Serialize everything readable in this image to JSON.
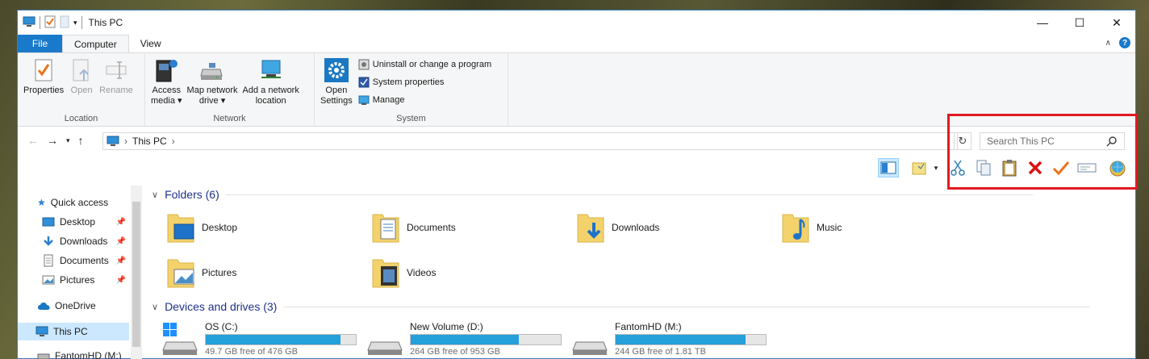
{
  "window": {
    "title": "This PC"
  },
  "controls": {
    "minimize": "—",
    "maximize": "☐",
    "close": "✕"
  },
  "tabs": [
    {
      "label": "File"
    },
    {
      "label": "Computer"
    },
    {
      "label": "View"
    }
  ],
  "ribbon": {
    "location": {
      "label": "Location",
      "properties": "Properties",
      "open": "Open",
      "rename": "Rename"
    },
    "network": {
      "label": "Network",
      "access_media_1": "Access",
      "access_media_2": "media",
      "map_drive_1": "Map network",
      "map_drive_2": "drive",
      "add_location_1": "Add a network",
      "add_location_2": "location"
    },
    "system": {
      "label": "System",
      "open_settings_1": "Open",
      "open_settings_2": "Settings",
      "uninstall": "Uninstall or change a program",
      "system_properties": "System properties",
      "manage": "Manage"
    }
  },
  "address": {
    "path": "This PC",
    "search_placeholder": "Search This PC"
  },
  "navpane": [
    {
      "label": "Quick access",
      "icon": "star-icon"
    },
    {
      "label": "Desktop",
      "icon": "desktop-icon",
      "pinned": true
    },
    {
      "label": "Downloads",
      "icon": "download-icon",
      "pinned": true
    },
    {
      "label": "Documents",
      "icon": "documents-icon",
      "pinned": true
    },
    {
      "label": "Pictures",
      "icon": "pictures-icon",
      "pinned": true
    },
    {
      "label": "OneDrive",
      "icon": "cloud-icon"
    },
    {
      "label": "This PC",
      "icon": "computer-icon",
      "selected": true
    },
    {
      "label": "FantomHD (M:)",
      "icon": "drive-icon"
    }
  ],
  "folders": {
    "header": "Folders (6)",
    "items": [
      {
        "label": "Desktop"
      },
      {
        "label": "Documents"
      },
      {
        "label": "Downloads"
      },
      {
        "label": "Music"
      },
      {
        "label": "Pictures"
      },
      {
        "label": "Videos"
      }
    ]
  },
  "drives": {
    "header": "Devices and drives (3)",
    "items": [
      {
        "label": "OS (C:)",
        "free": "49.7 GB free of 476 GB",
        "used_fraction": 0.896
      },
      {
        "label": "New Volume (D:)",
        "free": "264 GB free of 953 GB",
        "used_fraction": 0.723
      },
      {
        "label": "FantomHD (M:)",
        "free": "244 GB free of 1.81 TB",
        "used_fraction": 0.868
      }
    ]
  },
  "colors": {
    "accent": "#1979ca",
    "highlight_box": "#e01a22",
    "bar_fill": "#26a0da"
  }
}
